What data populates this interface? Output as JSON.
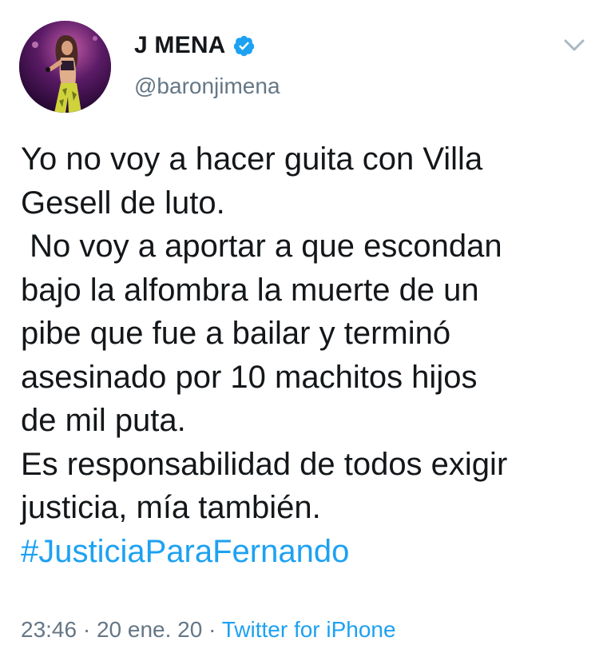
{
  "user": {
    "display_name": "J MENA",
    "handle": "@baronjimena",
    "verified_icon": "verified-badge-icon",
    "brand_color": "#1da1f2"
  },
  "tweet": {
    "lines": [
      "Yo no voy a hacer guita con Villa",
      "Gesell de luto.",
      " No voy a aportar a que escondan",
      "bajo la alfombra la muerte de un",
      "pibe que fue a bailar y terminó",
      "asesinado por 10 machitos hijos",
      "de mil puta.",
      "Es responsabilidad de todos exigir",
      "justicia, mía también."
    ],
    "hashtag": "#JusticiaParaFernando",
    "time": "23:46",
    "separator": " · ",
    "date": "20 ene. 20",
    "source": "Twitter for iPhone"
  },
  "colors": {
    "text": "#14171a",
    "secondary": "#657786",
    "link": "#1da1f2"
  }
}
